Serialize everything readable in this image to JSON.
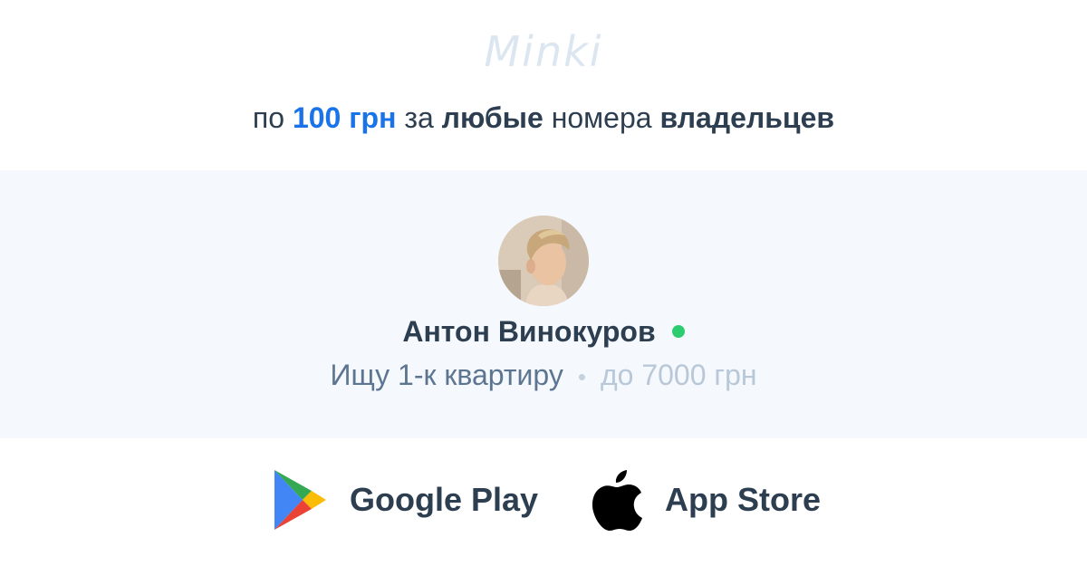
{
  "brand": {
    "logo_text": "Minki"
  },
  "tagline": {
    "part1": "по ",
    "price": "100 грн",
    "part2": " за ",
    "any": "любые",
    "part3": " номера ",
    "owners": "владельцев"
  },
  "profile": {
    "name": "Антон Винокуров",
    "online": true,
    "search_text": "Ищу 1-к квартиру",
    "separator": "•",
    "budget": "до 7000 грн"
  },
  "stores": {
    "google_play": {
      "label": "Google Play",
      "icon": "google-play-icon"
    },
    "app_store": {
      "label": "App Store",
      "icon": "apple-icon"
    }
  },
  "colors": {
    "accent": "#1a73e8",
    "text_dark": "#2c3e50",
    "online": "#2ecc71",
    "card_bg": "#f5f8fc"
  }
}
